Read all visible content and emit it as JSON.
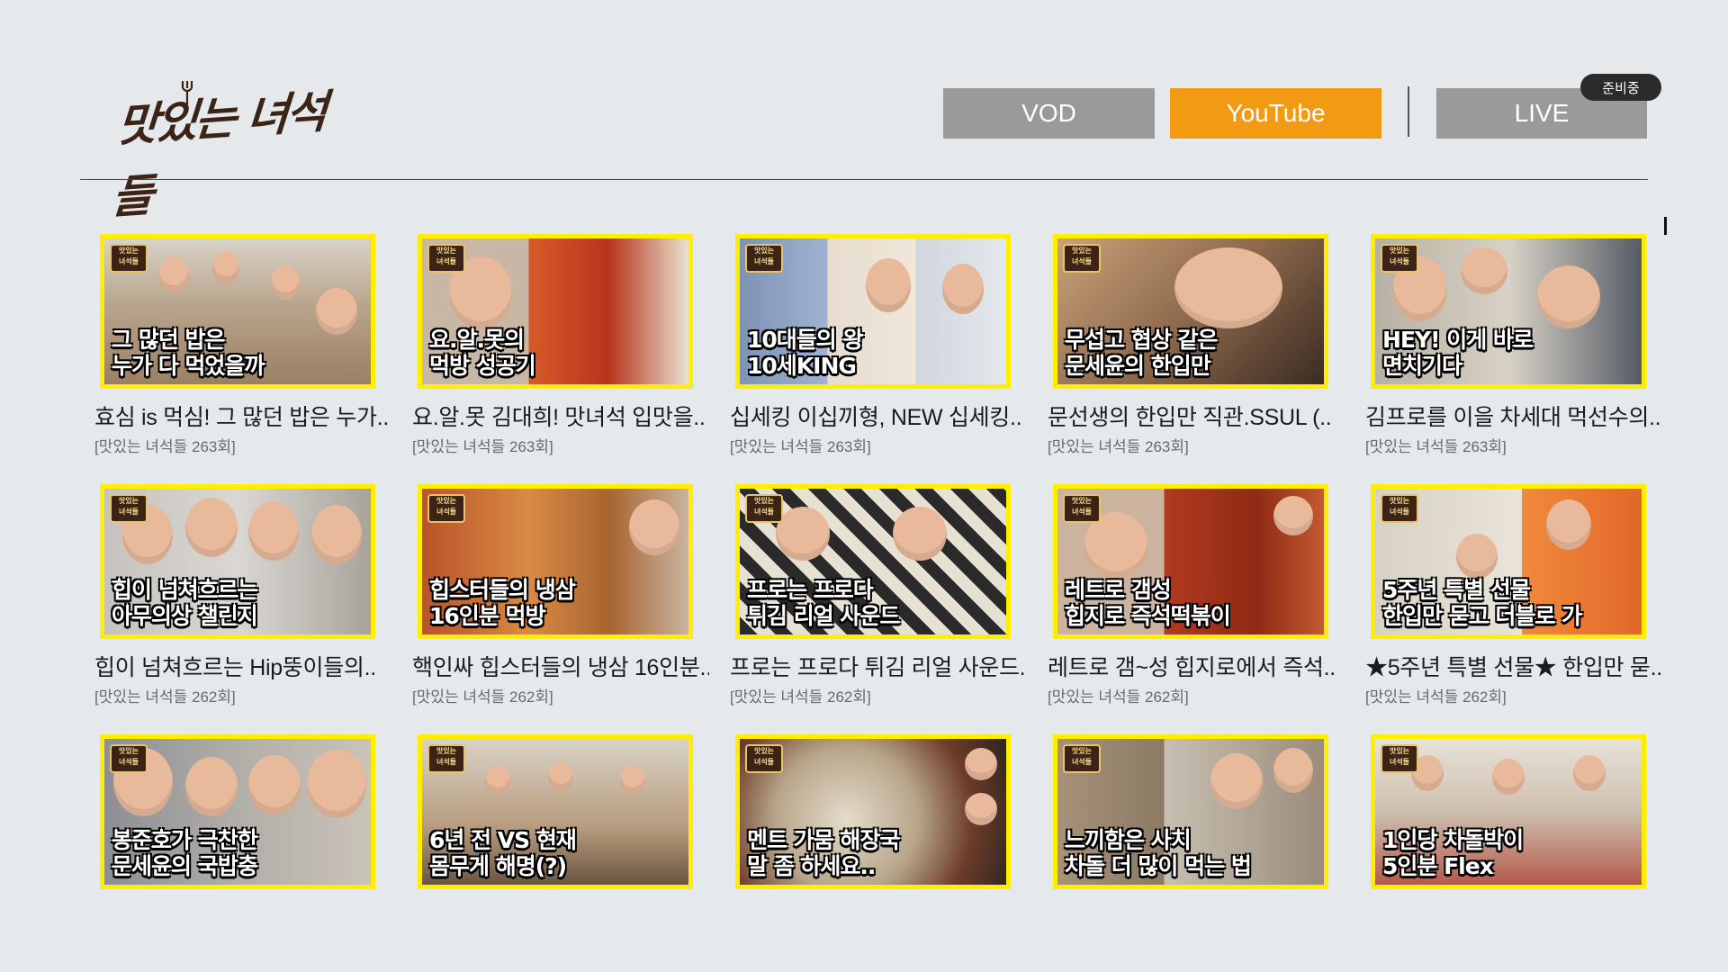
{
  "logo": {
    "text": "맛있는 녀석들"
  },
  "tabs": {
    "vod": "VOD",
    "youtube": "YouTube",
    "live": "LIVE",
    "live_badge": "준비중"
  },
  "colors": {
    "active_tab": "#f39a14",
    "inactive_tab": "#9a9a9a",
    "thumb_border": "#ffee00"
  },
  "videos": [
    {
      "caption": "그 많던 밥은\n누가 다 먹었을까",
      "title": "효심 is 먹심! 그 많던 밥은 누가..",
      "episode": "[맛있는 녀석들 263회]"
    },
    {
      "caption": "요.알.못의\n먹방 성공기",
      "title": "요.알.못 김대희! 맛녀석 입맛을..",
      "episode": "[맛있는 녀석들 263회]"
    },
    {
      "caption": "10대들의 왕\n10세KING",
      "title": "십세킹 이십끼형, NEW 십세킹..",
      "episode": "[맛있는 녀석들 263회]"
    },
    {
      "caption": "무섭고 협상 같은\n문세윤의 한입만",
      "title": "문선생의 한입만 직관.SSUL (..",
      "episode": "[맛있는 녀석들 263회]"
    },
    {
      "caption": "HEY! 이게 바로\n면치기다",
      "title": "김프로를 이을 차세대 먹선수의..",
      "episode": "[맛있는 녀석들 263회]"
    },
    {
      "caption": "힙이 넘쳐흐르는\n아무의상 챌린지",
      "title": "힙이 넘쳐흐르는 Hip뚱이들의..",
      "episode": "[맛있는 녀석들 262회]"
    },
    {
      "caption": "힙스터들의 냉삼\n16인분 먹방",
      "title": "핵인싸 힙스터들의 냉삼 16인분..",
      "episode": "[맛있는 녀석들 262회]"
    },
    {
      "caption": "프로는 프로다\n튀김 리얼 사운드",
      "title": "프로는 프로다 튀김 리얼 사운드..",
      "episode": "[맛있는 녀석들 262회]"
    },
    {
      "caption": "레트로 갬성\n힙지로 즉석떡볶이",
      "title": "레트로 갬~성 힙지로에서 즉석..",
      "episode": "[맛있는 녀석들 262회]"
    },
    {
      "caption": "5주년 특별 선물\n한입만 묻고 더블로 가",
      "title": "★5주년 특별 선물★ 한입만 묻..",
      "episode": "[맛있는 녀석들 262회]"
    },
    {
      "caption": "봉준호가 극찬한\n문세윤의 국밥충",
      "title": "",
      "episode": ""
    },
    {
      "caption": "6년 전 VS 현재\n몸무게 해명(?)",
      "title": "",
      "episode": ""
    },
    {
      "caption": "멘트 가뭄 해장국\n말 좀 하세요..",
      "title": "",
      "episode": ""
    },
    {
      "caption": "느끼함은 사치\n차돌 더 많이 먹는 법",
      "title": "",
      "episode": ""
    },
    {
      "caption": "1인당 차돌박이\n5인분 Flex",
      "title": "",
      "episode": ""
    }
  ]
}
